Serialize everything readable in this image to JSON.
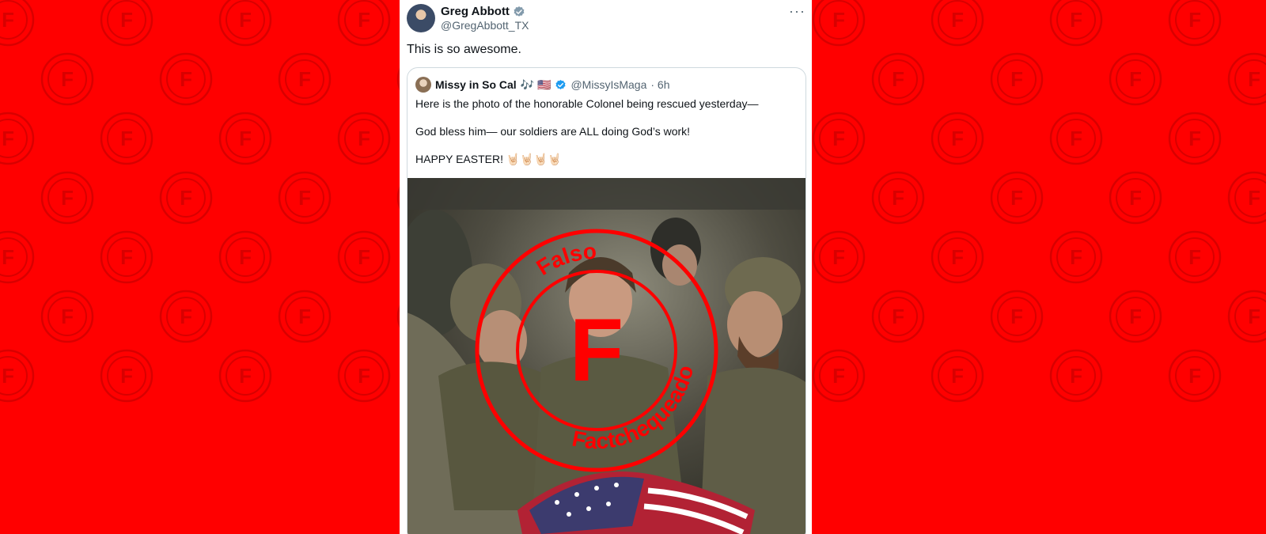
{
  "tweet": {
    "author_name": "Greg Abbott",
    "author_handle": "@GregAbbott_TX",
    "verified_badge": "gray-check-badge",
    "more_icon": "ellipsis-icon",
    "text": "This is so awesome."
  },
  "quote": {
    "name": "Missy in So Cal",
    "name_emojis": "🎶 🇺🇸",
    "handle": "@MissyIsMaga",
    "time": "· 6h",
    "verified_badge": "blue-check-badge",
    "line1": "Here is the photo of the honorable Colonel being rescued yesterday—",
    "line2": "God bless him— our soldiers are ALL doing God’s work!",
    "line3": "HAPPY EASTER! 🤘🏻🤘🏻🤘🏻🤘🏻"
  },
  "stamp": {
    "top_text": "Falso",
    "bottom_text": "Factchequeado",
    "letter": "F"
  },
  "colors": {
    "background": "#ff0000",
    "stamp_red": "#ff0000",
    "verified_blue": "#1d9bf0",
    "verified_gray": "#829aab"
  }
}
